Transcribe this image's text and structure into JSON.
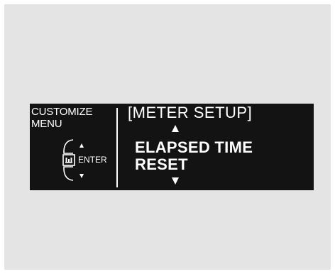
{
  "left_panel": {
    "title_line1": "CUSTOMIZE",
    "title_line2": "MENU",
    "enter_label": "ENTER",
    "icons": [
      "up-arrow-icon",
      "enter-button-icon",
      "down-arrow-icon"
    ]
  },
  "right_panel": {
    "title_open": "[",
    "title": "METER SETUP",
    "title_close": "]",
    "items": [
      "ELAPSED TIME",
      "RESET"
    ]
  },
  "colors": {
    "display_bg": "#131313",
    "text": "#ffffff",
    "frame_bg": "#e4e4e4"
  }
}
